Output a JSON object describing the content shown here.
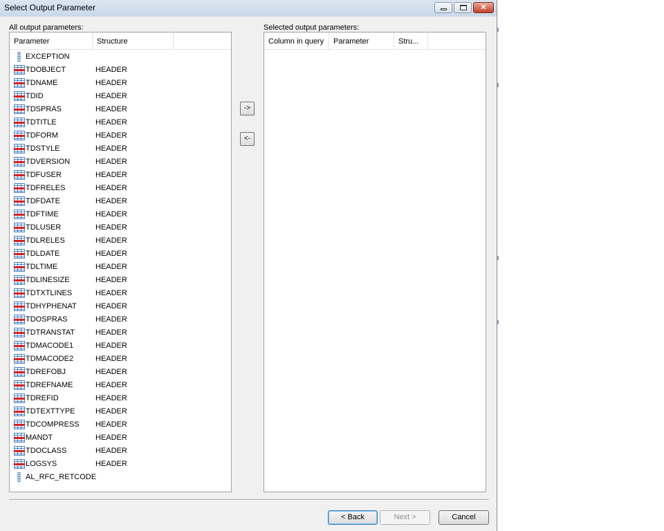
{
  "window": {
    "title": "Select Output Parameter",
    "minimize": "–",
    "maximize": "□",
    "close": "✕"
  },
  "left_panel": {
    "label": "All output parameters:",
    "columns": [
      "Parameter",
      "Structure"
    ],
    "rows": [
      {
        "param": "EXCEPTION",
        "structure": "",
        "icon": "scalar-param-icon"
      },
      {
        "param": "TDOBJECT",
        "structure": "HEADER",
        "icon": "structure-field-icon"
      },
      {
        "param": "TDNAME",
        "structure": "HEADER",
        "icon": "structure-field-icon"
      },
      {
        "param": "TDID",
        "structure": "HEADER",
        "icon": "structure-field-icon"
      },
      {
        "param": "TDSPRAS",
        "structure": "HEADER",
        "icon": "structure-field-icon"
      },
      {
        "param": "TDTITLE",
        "structure": "HEADER",
        "icon": "structure-field-icon"
      },
      {
        "param": "TDFORM",
        "structure": "HEADER",
        "icon": "structure-field-icon"
      },
      {
        "param": "TDSTYLE",
        "structure": "HEADER",
        "icon": "structure-field-icon"
      },
      {
        "param": "TDVERSION",
        "structure": "HEADER",
        "icon": "structure-field-icon"
      },
      {
        "param": "TDFUSER",
        "structure": "HEADER",
        "icon": "structure-field-icon"
      },
      {
        "param": "TDFRELES",
        "structure": "HEADER",
        "icon": "structure-field-icon"
      },
      {
        "param": "TDFDATE",
        "structure": "HEADER",
        "icon": "structure-field-icon"
      },
      {
        "param": "TDFTIME",
        "structure": "HEADER",
        "icon": "structure-field-icon"
      },
      {
        "param": "TDLUSER",
        "structure": "HEADER",
        "icon": "structure-field-icon"
      },
      {
        "param": "TDLRELES",
        "structure": "HEADER",
        "icon": "structure-field-icon"
      },
      {
        "param": "TDLDATE",
        "structure": "HEADER",
        "icon": "structure-field-icon"
      },
      {
        "param": "TDLTIME",
        "structure": "HEADER",
        "icon": "structure-field-icon"
      },
      {
        "param": "TDLINESIZE",
        "structure": "HEADER",
        "icon": "structure-field-icon"
      },
      {
        "param": "TDTXTLINES",
        "structure": "HEADER",
        "icon": "structure-field-icon"
      },
      {
        "param": "TDHYPHENAT",
        "structure": "HEADER",
        "icon": "structure-field-icon"
      },
      {
        "param": "TDOSPRAS",
        "structure": "HEADER",
        "icon": "structure-field-icon"
      },
      {
        "param": "TDTRANSTAT",
        "structure": "HEADER",
        "icon": "structure-field-icon"
      },
      {
        "param": "TDMACODE1",
        "structure": "HEADER",
        "icon": "structure-field-icon"
      },
      {
        "param": "TDMACODE2",
        "structure": "HEADER",
        "icon": "structure-field-icon"
      },
      {
        "param": "TDREFOBJ",
        "structure": "HEADER",
        "icon": "structure-field-icon"
      },
      {
        "param": "TDREFNAME",
        "structure": "HEADER",
        "icon": "structure-field-icon"
      },
      {
        "param": "TDREFID",
        "structure": "HEADER",
        "icon": "structure-field-icon"
      },
      {
        "param": "TDTEXTTYPE",
        "structure": "HEADER",
        "icon": "structure-field-icon"
      },
      {
        "param": "TDCOMPRESS",
        "structure": "HEADER",
        "icon": "structure-field-icon"
      },
      {
        "param": "MANDT",
        "structure": "HEADER",
        "icon": "structure-field-icon"
      },
      {
        "param": "TDOCLASS",
        "structure": "HEADER",
        "icon": "structure-field-icon"
      },
      {
        "param": "LOGSYS",
        "structure": "HEADER",
        "icon": "structure-field-icon"
      },
      {
        "param": "AL_RFC_RETCODE",
        "structure": "",
        "icon": "scalar-param-icon"
      }
    ]
  },
  "right_panel": {
    "label": "Selected output parameters:",
    "columns": [
      "Column in query",
      "Parameter",
      "Stru..."
    ],
    "rows": []
  },
  "move_buttons": {
    "add": "->",
    "remove": "<-"
  },
  "footer": {
    "back": "< Back",
    "next": "Next >",
    "cancel": "Cancel"
  },
  "colors": {
    "icon_blue": "#4a7fc1",
    "icon_red": "#d62020",
    "title_bg": "#dbe5f1",
    "dialog_bg": "#f0f0f0"
  }
}
